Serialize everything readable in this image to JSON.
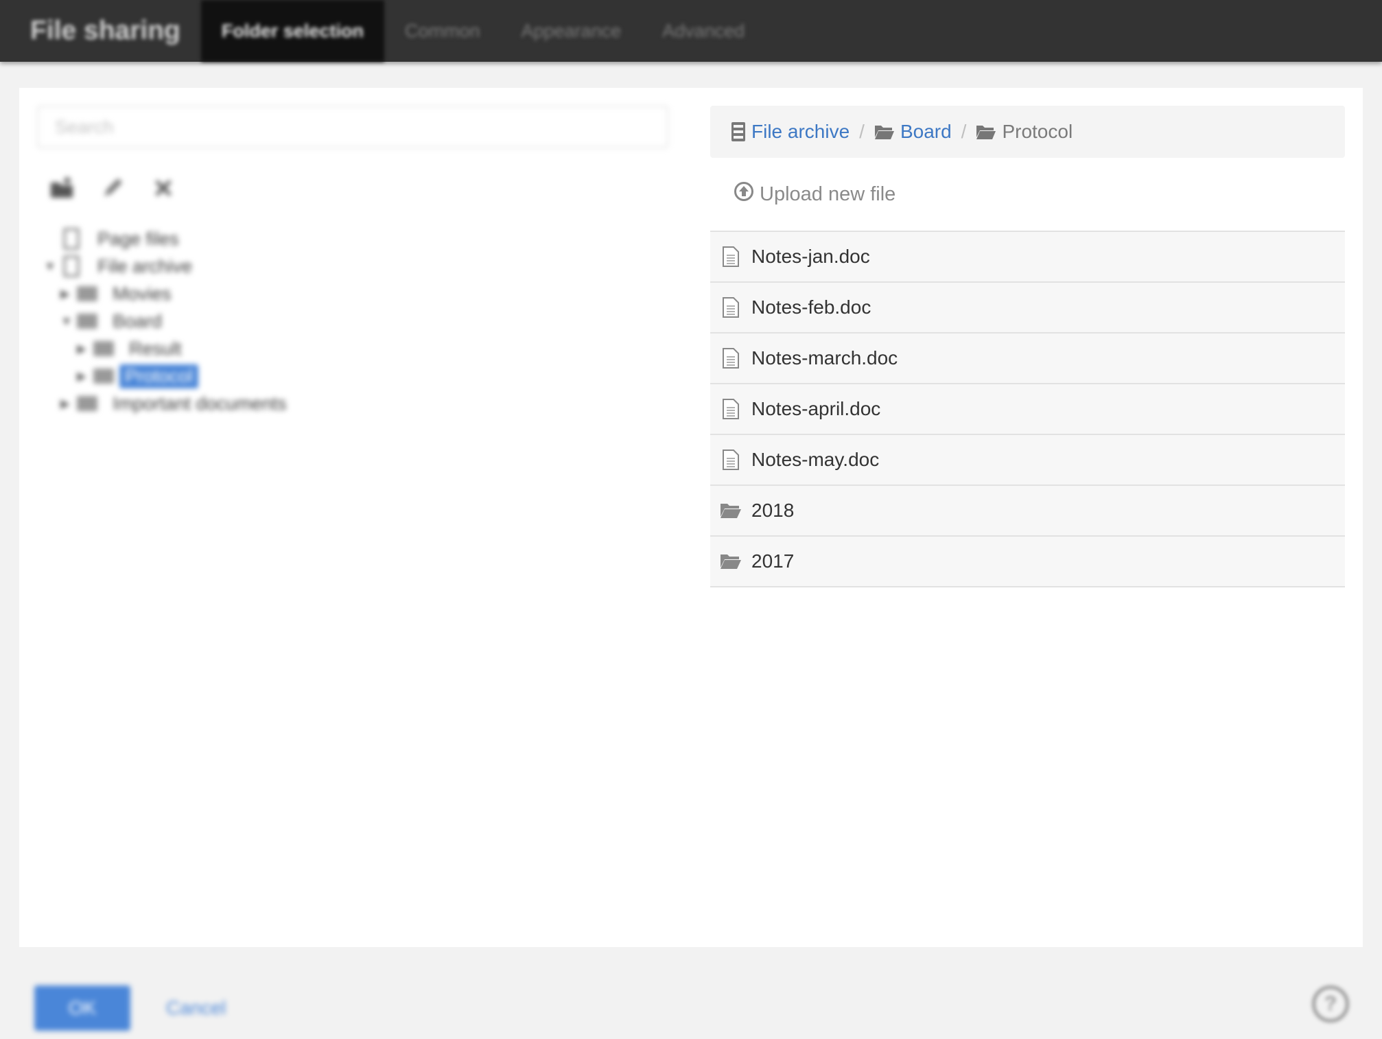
{
  "header": {
    "app_title": "File sharing",
    "tabs": [
      {
        "label": "Folder selection",
        "active": true
      },
      {
        "label": "Common",
        "active": false
      },
      {
        "label": "Appearance",
        "active": false
      },
      {
        "label": "Advanced",
        "active": false
      }
    ]
  },
  "left_pane": {
    "search_placeholder": "Search",
    "tools": [
      "new-folder-icon",
      "pencil-icon",
      "close-icon"
    ],
    "tree": [
      {
        "label": "Page files",
        "icon": "database-icon",
        "caret": ""
      },
      {
        "label": "File archive",
        "icon": "database-icon",
        "caret": "▼"
      },
      {
        "label": "Movies",
        "icon": "folder-icon",
        "caret": "▶"
      },
      {
        "label": "Board",
        "icon": "folder-icon",
        "caret": "▼"
      },
      {
        "label": "Result",
        "icon": "folder-icon",
        "caret": "▶"
      },
      {
        "label": "Protocol",
        "icon": "folder-icon",
        "caret": "▶",
        "selected": true
      },
      {
        "label": "Important documents",
        "icon": "folder-icon",
        "caret": "▶"
      }
    ]
  },
  "right_pane": {
    "breadcrumb": [
      {
        "label": "File archive",
        "icon": "archive-icon"
      },
      {
        "label": "Board",
        "icon": "folder-open-icon"
      },
      {
        "label": "Protocol",
        "icon": "folder-open-icon"
      }
    ],
    "upload_label": "Upload new file",
    "files": [
      {
        "name": "Notes-jan.doc",
        "icon": "document-icon"
      },
      {
        "name": "Notes-feb.doc",
        "icon": "document-icon"
      },
      {
        "name": "Notes-march.doc",
        "icon": "document-icon"
      },
      {
        "name": "Notes-april.doc",
        "icon": "document-icon"
      },
      {
        "name": "Notes-may.doc",
        "icon": "document-icon"
      },
      {
        "name": "2018",
        "icon": "folder-open-icon"
      },
      {
        "name": "2017",
        "icon": "folder-open-icon"
      }
    ]
  },
  "footer": {
    "ok_label": "OK",
    "cancel_label": "Cancel",
    "help_label": "?"
  },
  "colors": {
    "accent": "#4a86d8",
    "link": "#3d78c4",
    "header_bg": "#333333"
  }
}
